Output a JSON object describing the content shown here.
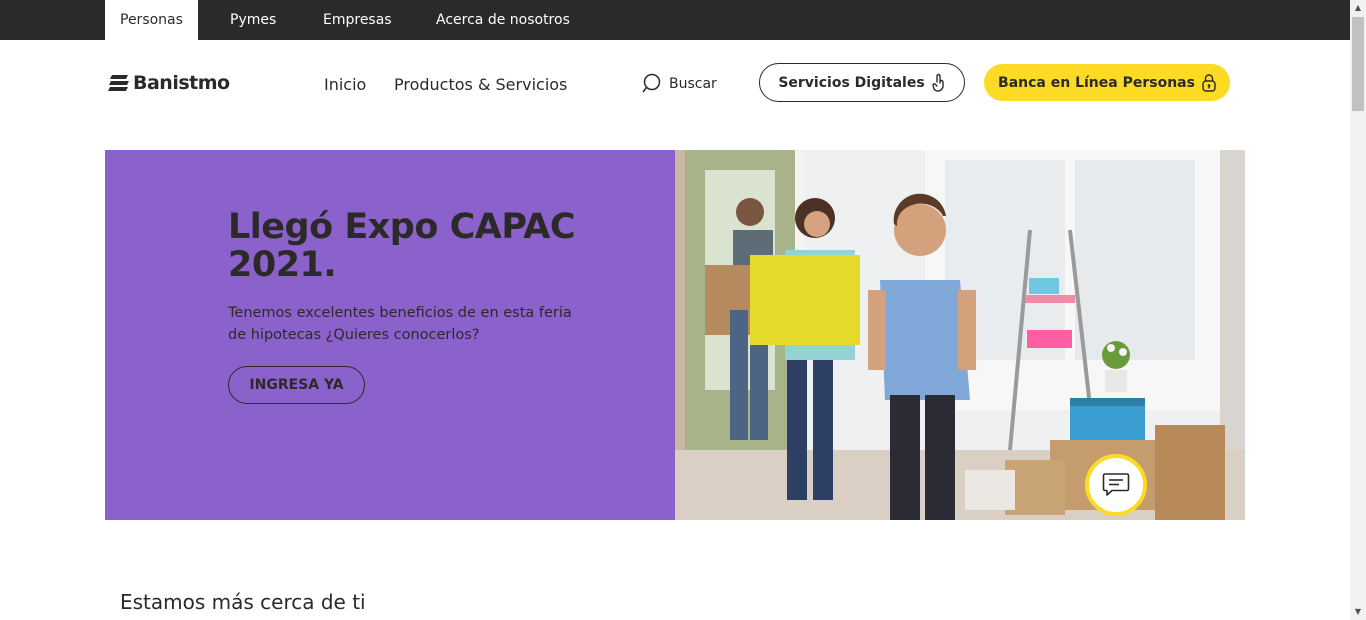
{
  "topnav": {
    "tabs": [
      {
        "label": "Personas",
        "active": true
      },
      {
        "label": "Pymes",
        "active": false
      },
      {
        "label": "Empresas",
        "active": false
      },
      {
        "label": "Acerca de nosotros",
        "active": false
      }
    ]
  },
  "header": {
    "logo_text": "Banistmo",
    "nav": {
      "inicio": "Inicio",
      "productos": "Productos & Servicios"
    },
    "search_label": "Buscar",
    "digital_button": "Servicios Digitales",
    "banca_button": "Banca en Línea Personas"
  },
  "hero": {
    "title": "Llegó Expo CAPAC 2021.",
    "text": "Tenemos excelentes beneficios de en esta feria de hipotecas ¿Quieres conocerlos?",
    "button": "INGRESA YA"
  },
  "section": {
    "title": "Estamos más cerca de ti"
  },
  "colors": {
    "brand_yellow": "#fdda24",
    "hero_purple": "#8b61cc",
    "dark": "#2c2a29"
  }
}
